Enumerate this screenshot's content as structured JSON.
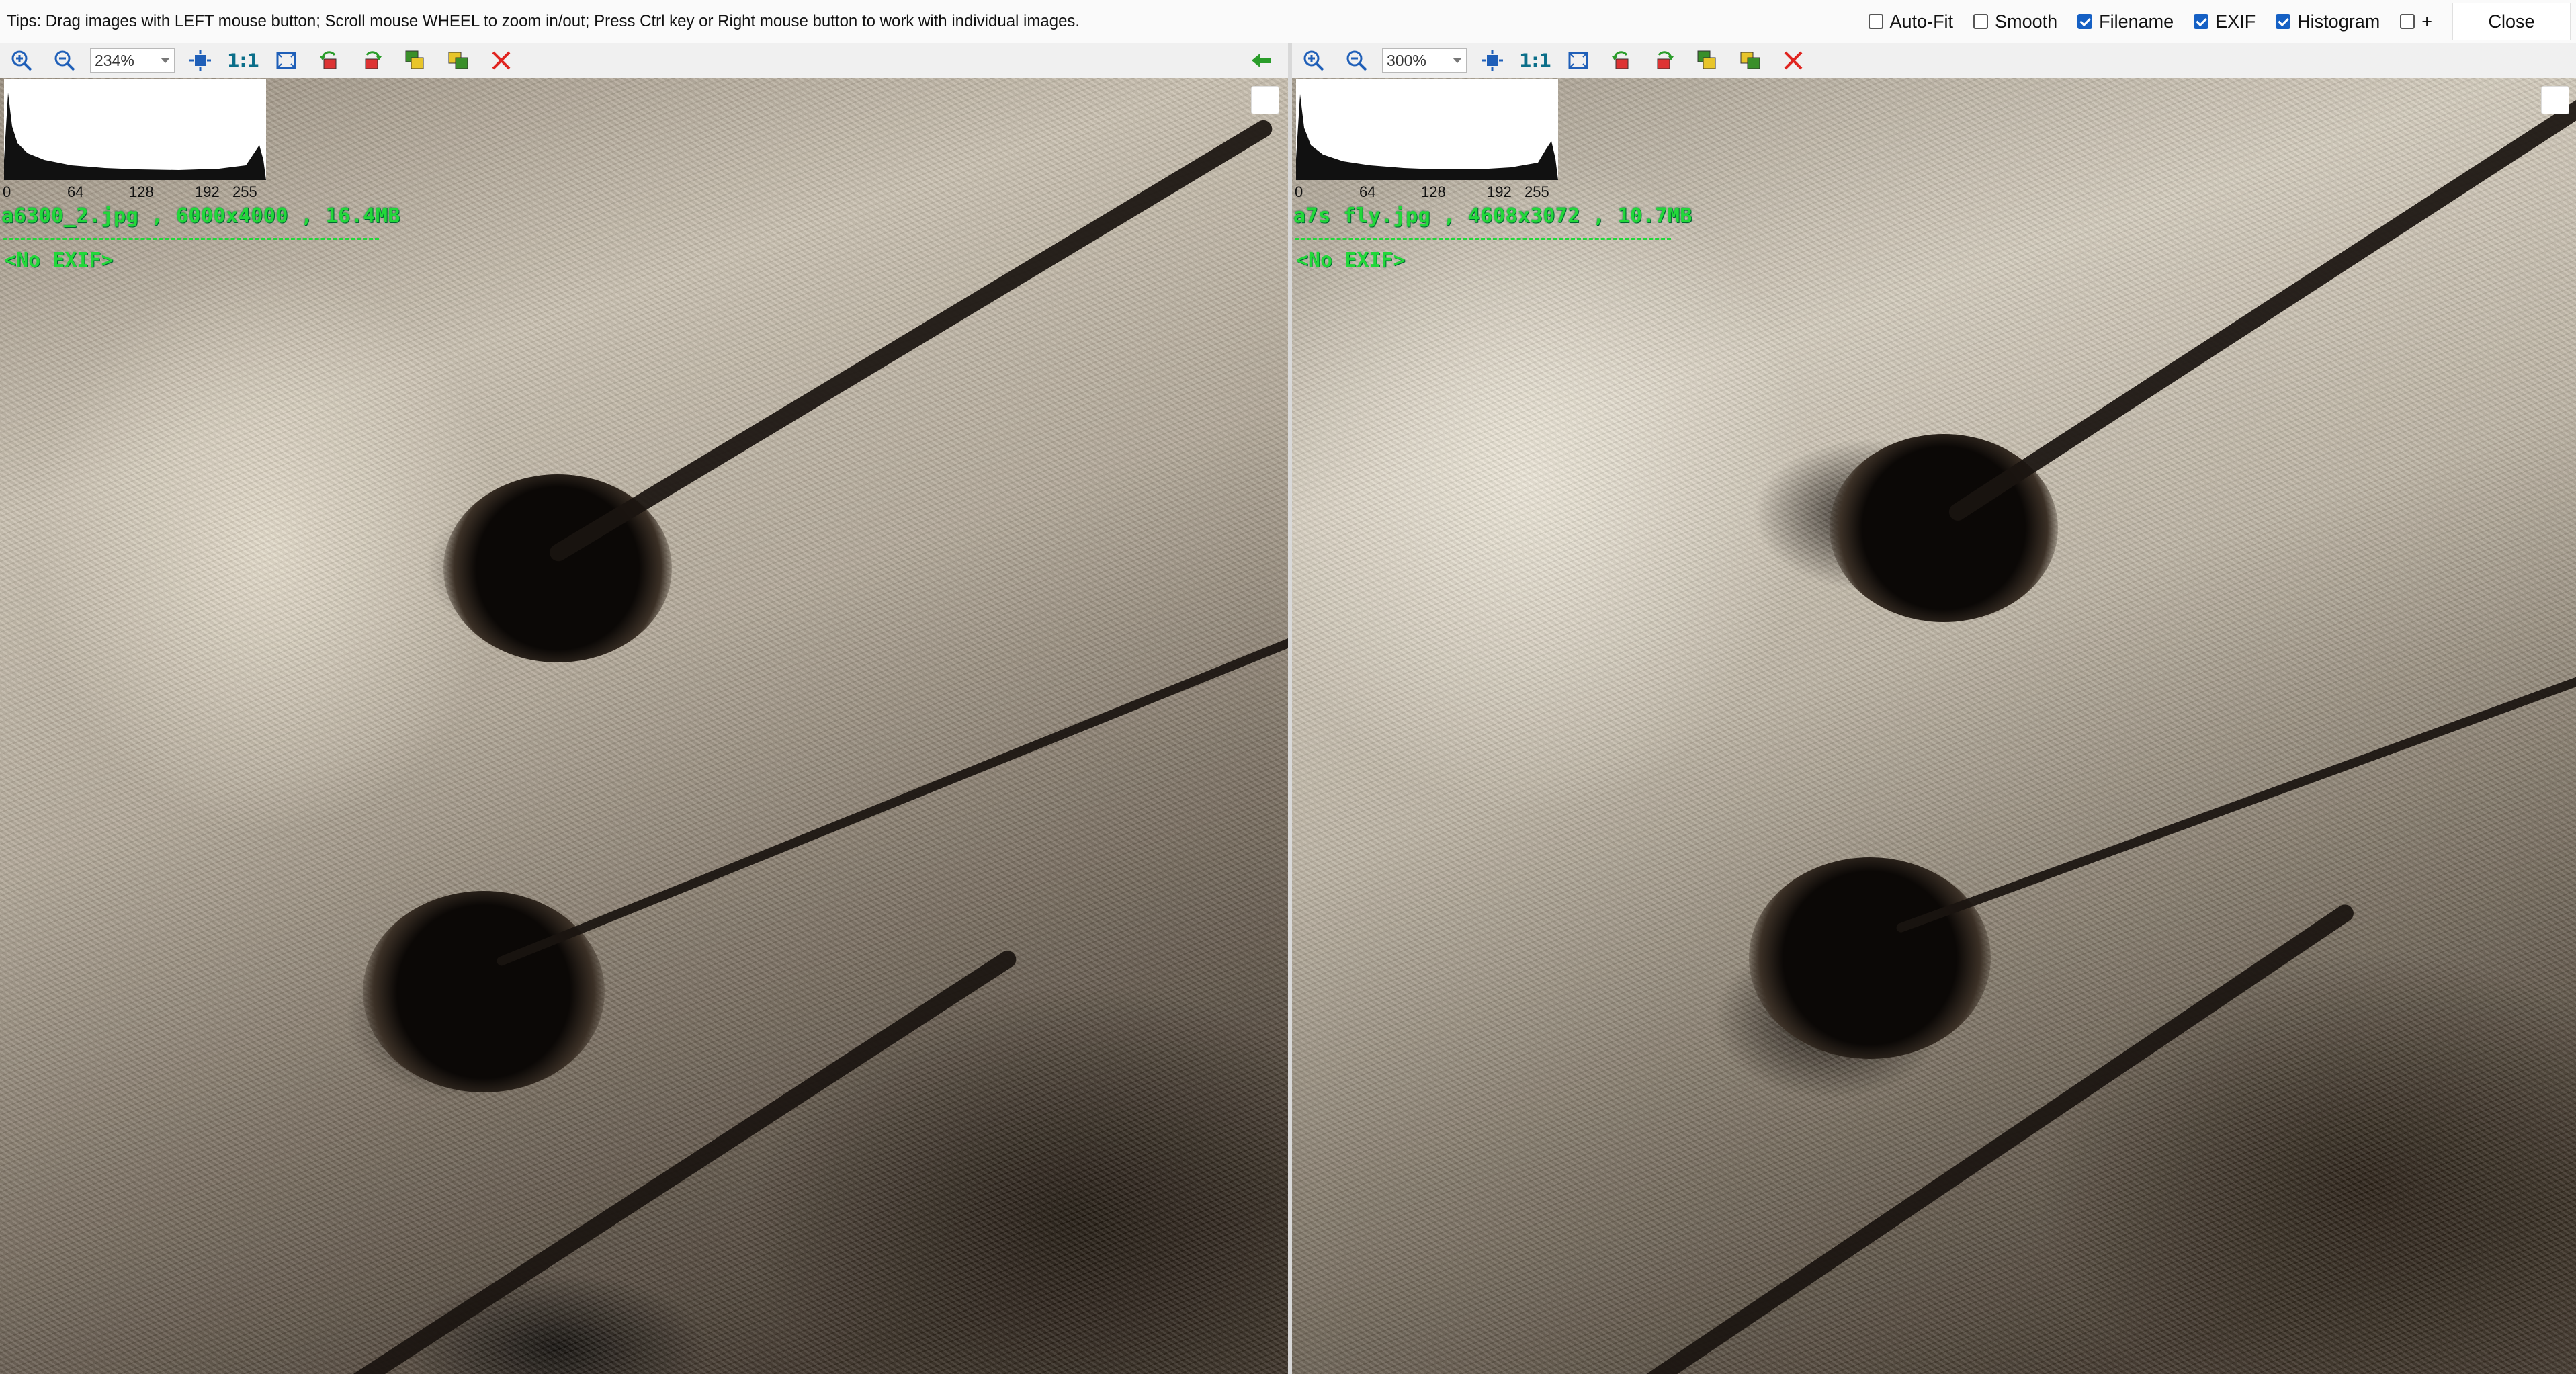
{
  "tips": "Tips: Drag images with LEFT mouse button; Scroll mouse WHEEL to zoom in/out; Press Ctrl key or Right mouse button to work with individual images.",
  "options": [
    {
      "label": "Auto-Fit",
      "checked": false
    },
    {
      "label": "Smooth",
      "checked": false
    },
    {
      "label": "Filename",
      "checked": true
    },
    {
      "label": "EXIF",
      "checked": true
    },
    {
      "label": "Histogram",
      "checked": true
    },
    {
      "label": "+",
      "checked": false
    }
  ],
  "close_label": "Close",
  "panes": [
    {
      "zoom": "234%",
      "one_to_one": "1:1",
      "file_info": "a6300_2.jpg , 6000x4000 , 16.4MB",
      "exif": "<No EXIF>",
      "hist_ticks": [
        "0",
        "64",
        "128",
        "192",
        "255"
      ]
    },
    {
      "zoom": "300%",
      "one_to_one": "1:1",
      "file_info": "a7s fly.jpg , 4608x3072 , 10.7MB",
      "exif": "<No EXIF>",
      "hist_ticks": [
        "0",
        "64",
        "128",
        "192",
        "255"
      ]
    }
  ],
  "icons": {
    "zoom_in": "zoom-in-icon",
    "zoom_out": "zoom-out-icon",
    "fit": "fit-to-window-icon",
    "actual": "actual-size-icon",
    "fullscreen": "fullscreen-icon",
    "rotate_left": "rotate-left-icon",
    "rotate_right": "rotate-right-icon",
    "copy": "copy-icon",
    "save": "save-icon",
    "close": "close-x-icon",
    "sync": "sync-arrow-icon"
  },
  "colors": {
    "overlay_text": "#22d83a",
    "close_x": "#e0241f",
    "toolbar_blue": "#1f5fb8"
  }
}
